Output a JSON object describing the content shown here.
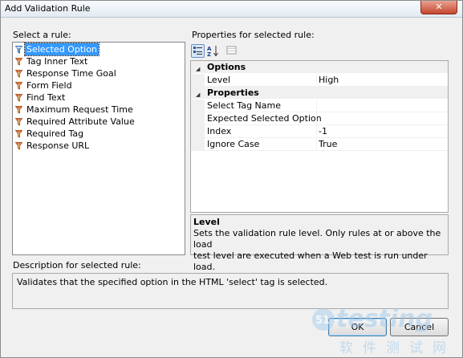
{
  "window": {
    "title": "Add Validation Rule",
    "close_glyph": "✕"
  },
  "rules": {
    "label": "Select a rule:",
    "items": [
      {
        "label": "Selected Option",
        "selected": true
      },
      {
        "label": "Tag Inner Text"
      },
      {
        "label": "Response Time Goal"
      },
      {
        "label": "Form Field"
      },
      {
        "label": "Find Text"
      },
      {
        "label": "Maximum Request Time"
      },
      {
        "label": "Required Attribute Value"
      },
      {
        "label": "Required Tag"
      },
      {
        "label": "Response URL"
      }
    ]
  },
  "properties": {
    "label": "Properties for selected rule:",
    "toolbar": [
      "categorized-icon",
      "alphabetical-icon",
      "property-pages-icon"
    ],
    "categories": [
      {
        "name": "Options",
        "props": [
          {
            "name": "Level",
            "value": "High"
          }
        ]
      },
      {
        "name": "Properties",
        "props": [
          {
            "name": "Select Tag Name",
            "value": ""
          },
          {
            "name": "Expected Selected Option",
            "value": ""
          },
          {
            "name": "Index",
            "value": "-1"
          },
          {
            "name": "Ignore Case",
            "value": "True"
          }
        ]
      }
    ],
    "help": {
      "title": "Level",
      "lines": [
        "Sets the validation rule level.  Only rules at or above the load",
        "test level are executed when a Web test is run under load."
      ]
    }
  },
  "description": {
    "label": "Description for selected rule:",
    "text": "Validates that the specified option in the HTML 'select' tag is selected."
  },
  "buttons": {
    "ok": "OK",
    "cancel": "Cancel"
  },
  "watermark": {
    "brand": "testing",
    "number": "51",
    "sub": "软件测试网"
  },
  "colors": {
    "selection": "#3399ff",
    "window_bg": "#f0f0f0",
    "close_button": "#c7452d"
  }
}
